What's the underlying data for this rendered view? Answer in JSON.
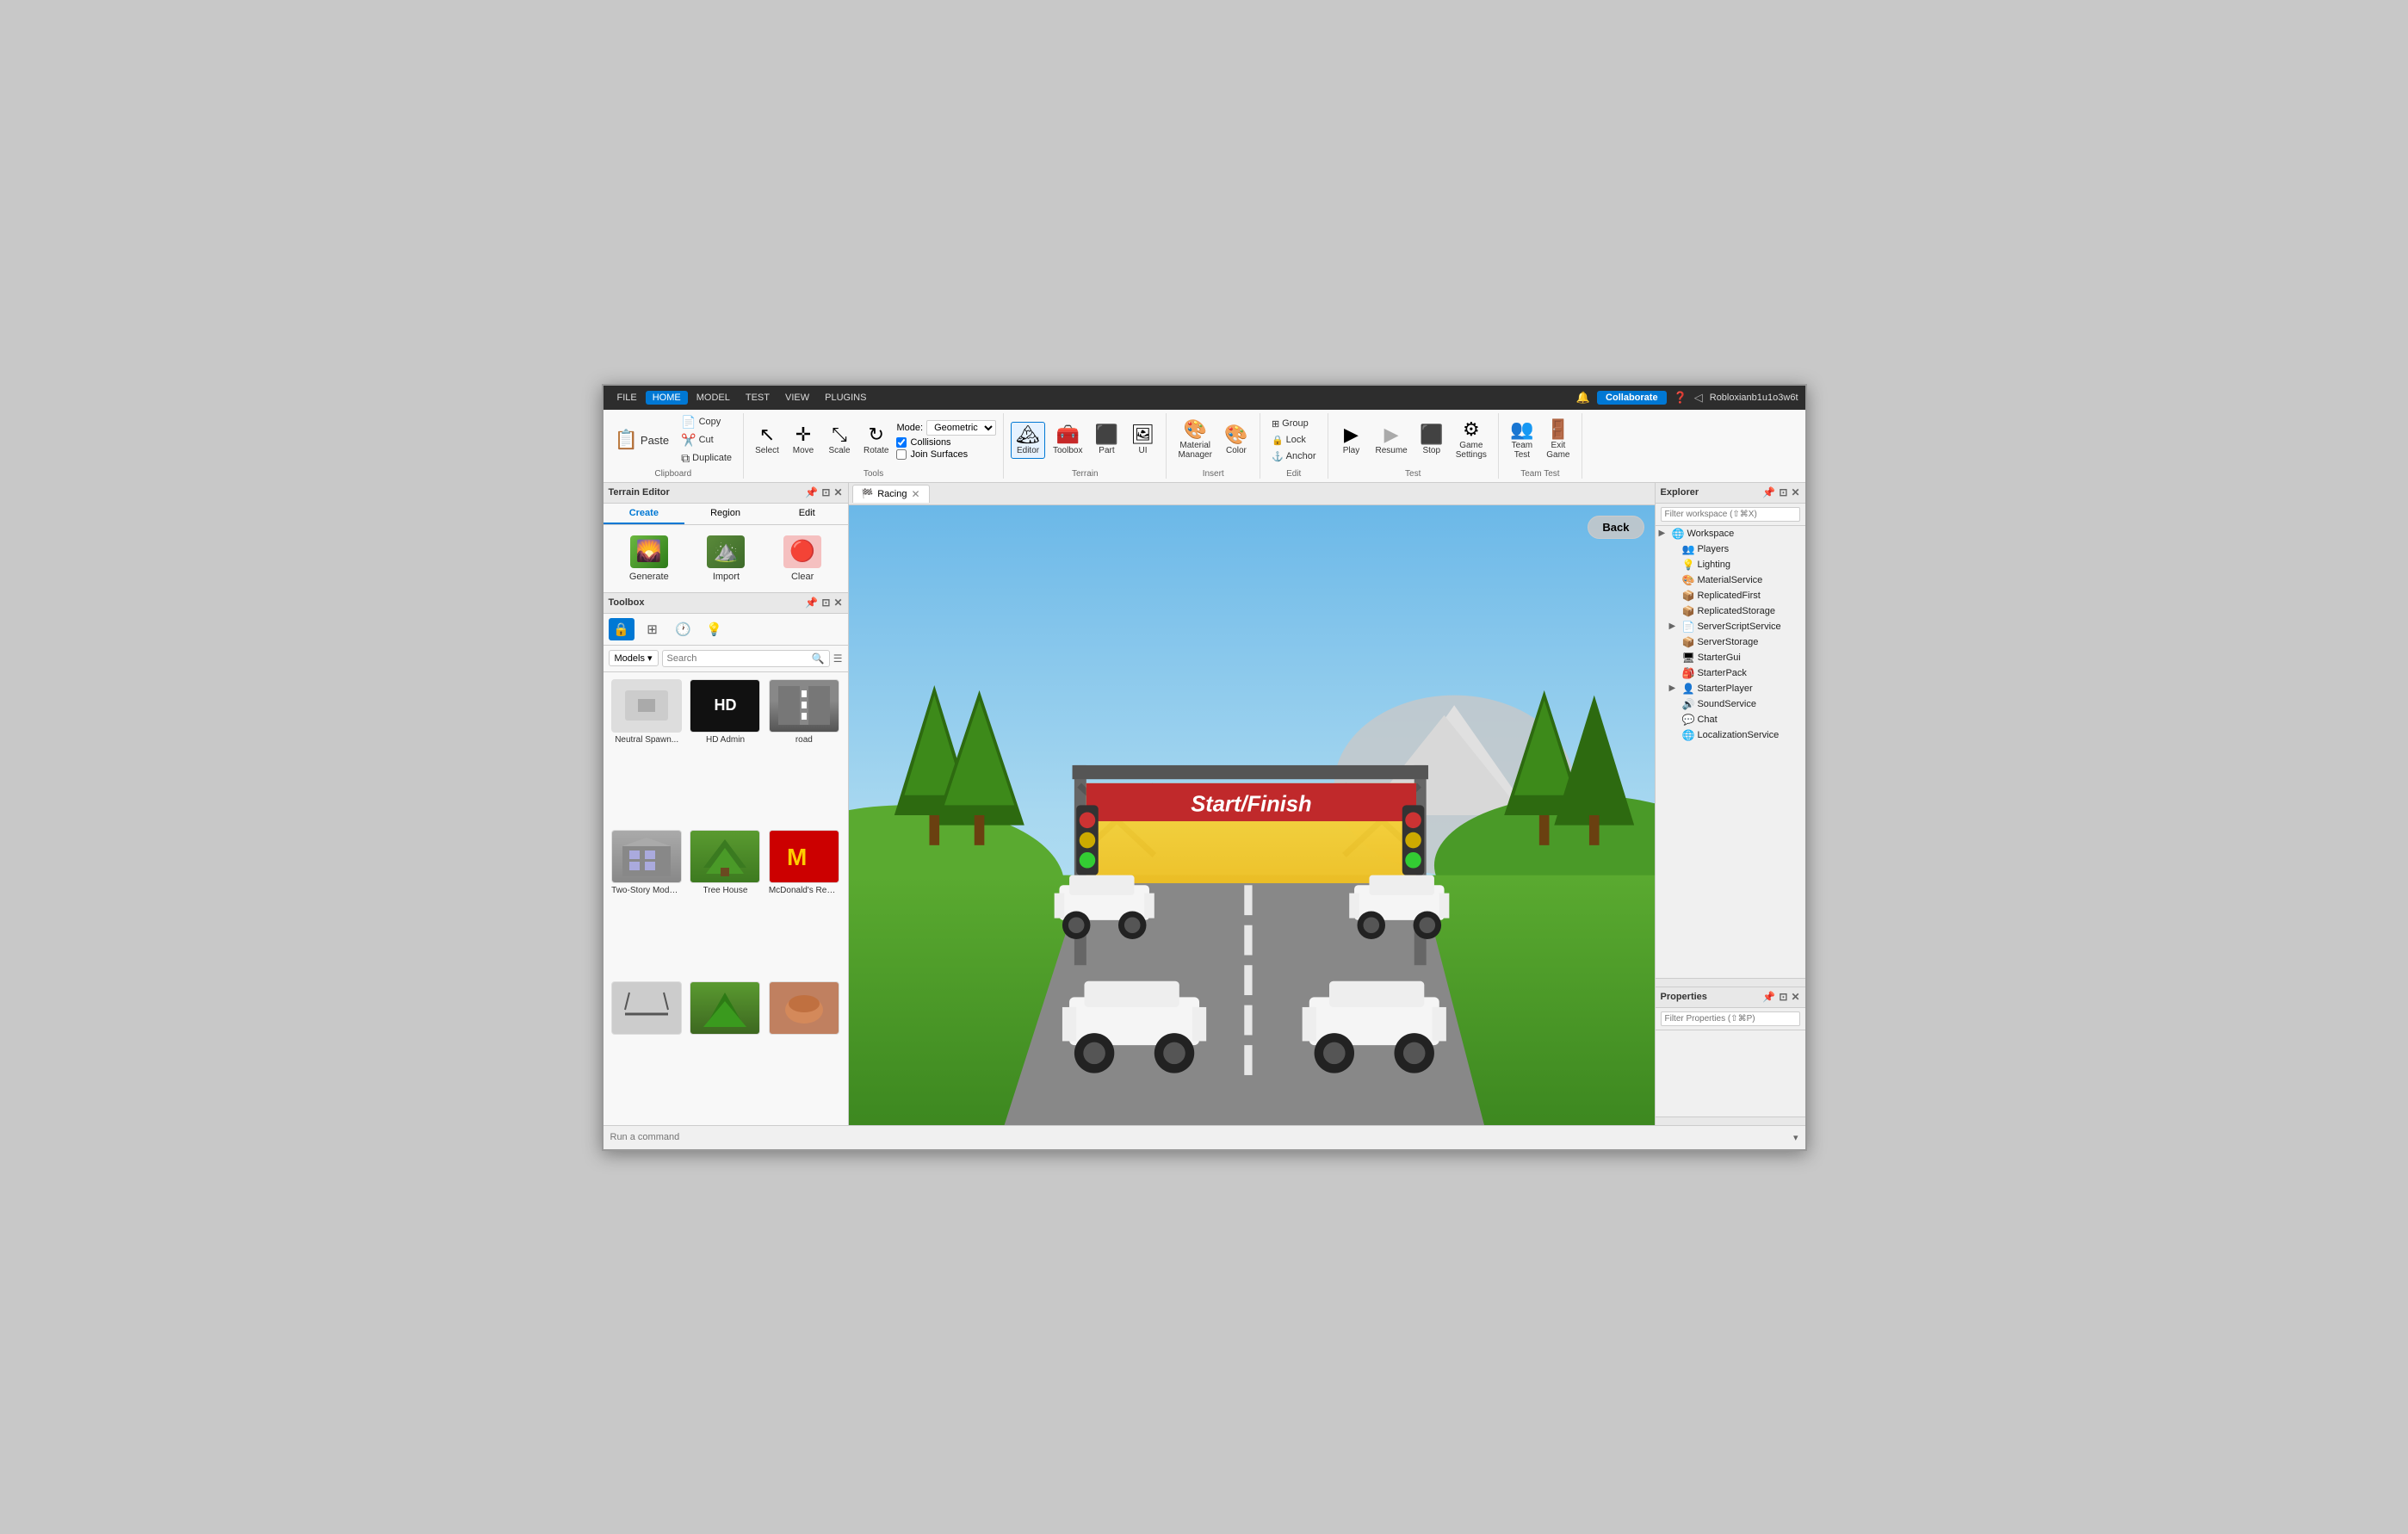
{
  "titlebar": {
    "menu_items": [
      "FILE",
      "HOME",
      "MODEL",
      "TEST",
      "VIEW",
      "PLUGINS"
    ],
    "active_menu": "HOME",
    "collaborate_label": "Collaborate",
    "user_name": "Robloxianb1u1o3w6t",
    "icons": [
      "🔔",
      "❓",
      "◁"
    ]
  },
  "ribbon": {
    "clipboard": {
      "paste_label": "Paste",
      "copy_label": "Copy",
      "cut_label": "Cut",
      "duplicate_label": "Duplicate",
      "group_label": "Clipboard"
    },
    "tools": {
      "select_label": "Select",
      "move_label": "Move",
      "scale_label": "Scale",
      "rotate_label": "Rotate",
      "mode_label": "Mode:",
      "mode_value": "Geometric",
      "collisions_label": "Collisions",
      "join_surfaces_label": "Join Surfaces",
      "group_label": "Tools"
    },
    "terrain": {
      "editor_label": "Editor",
      "toolbox_label": "Toolbox",
      "part_label": "Part",
      "ui_label": "UI",
      "group_label": "Terrain"
    },
    "insert": {
      "material_manager_label": "Material\nManager",
      "color_label": "Color",
      "group_label": "Insert"
    },
    "edit": {
      "group_label": "Group",
      "lock_label": "Lock",
      "anchor_label": "Anchor",
      "group_section_label": "Edit"
    },
    "test": {
      "play_label": "Play",
      "resume_label": "Resume",
      "stop_label": "Stop",
      "game_settings_label": "Game\nSettings",
      "group_label": "Test"
    },
    "team_test": {
      "team_test_label": "Team\nTest",
      "exit_game_label": "Exit\nGame",
      "group_label": "Team Test"
    }
  },
  "terrain_editor": {
    "title": "Terrain Editor",
    "tabs": [
      "Create",
      "Region",
      "Edit"
    ],
    "active_tab": "Create",
    "tools": [
      {
        "label": "Generate",
        "icon": "🌄"
      },
      {
        "label": "Import",
        "icon": "⛰️"
      },
      {
        "label": "Clear",
        "icon": "🔴"
      }
    ]
  },
  "toolbox": {
    "title": "Toolbox",
    "category_label": "Models",
    "search_placeholder": "Search",
    "icon_tabs": [
      "🔒",
      "⊞",
      "🕐",
      "💡"
    ],
    "items": [
      {
        "label": "Neutral Spawn...",
        "type": "spawn"
      },
      {
        "label": "HD Admin",
        "type": "hd"
      },
      {
        "label": "road",
        "type": "road"
      },
      {
        "label": "Two-Story Modern...",
        "type": "building"
      },
      {
        "label": "Tree House",
        "type": "tree"
      },
      {
        "label": "McDonald's Restaurant",
        "type": "mcdonalds"
      },
      {
        "label": "",
        "type": "spawn"
      },
      {
        "label": "",
        "type": "tree"
      },
      {
        "label": "",
        "type": "building"
      }
    ]
  },
  "viewport": {
    "tab_label": "Racing",
    "back_button_label": "Back",
    "scene": {
      "start_finish_text": "Start/Finish"
    }
  },
  "explorer": {
    "title": "Explorer",
    "filter_placeholder": "Filter workspace (⇧⌘X)",
    "items": [
      {
        "label": "Workspace",
        "icon": "🌐",
        "indent": 0,
        "expandable": true
      },
      {
        "label": "Players",
        "icon": "👥",
        "indent": 1,
        "expandable": false
      },
      {
        "label": "Lighting",
        "icon": "💡",
        "indent": 1,
        "expandable": false
      },
      {
        "label": "MaterialService",
        "icon": "🎨",
        "indent": 1,
        "expandable": false
      },
      {
        "label": "ReplicatedFirst",
        "icon": "📦",
        "indent": 1,
        "expandable": false
      },
      {
        "label": "ReplicatedStorage",
        "icon": "📦",
        "indent": 1,
        "expandable": false
      },
      {
        "label": "ServerScriptService",
        "icon": "📄",
        "indent": 1,
        "expandable": true
      },
      {
        "label": "ServerStorage",
        "icon": "📦",
        "indent": 1,
        "expandable": false
      },
      {
        "label": "StarterGui",
        "icon": "🖥",
        "indent": 1,
        "expandable": false
      },
      {
        "label": "StarterPack",
        "icon": "🎒",
        "indent": 1,
        "expandable": false
      },
      {
        "label": "StarterPlayer",
        "icon": "👤",
        "indent": 1,
        "expandable": true
      },
      {
        "label": "SoundService",
        "icon": "🔊",
        "indent": 1,
        "expandable": false
      },
      {
        "label": "Chat",
        "icon": "💬",
        "indent": 1,
        "expandable": false
      },
      {
        "label": "LocalizationService",
        "icon": "🌐",
        "indent": 1,
        "expandable": false
      }
    ]
  },
  "properties": {
    "title": "Properties",
    "filter_placeholder": "Filter Properties (⇧⌘P)"
  },
  "bottom_bar": {
    "command_placeholder": "Run a command"
  }
}
